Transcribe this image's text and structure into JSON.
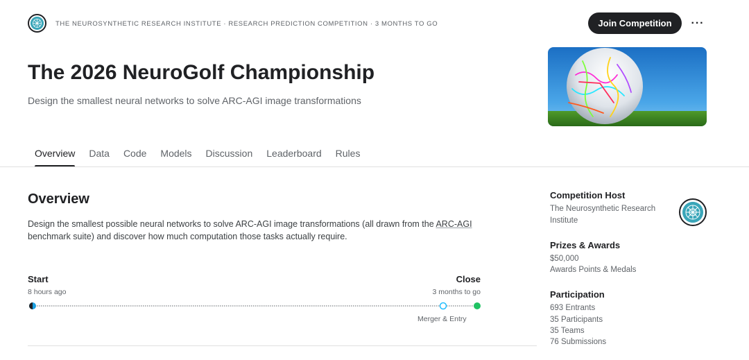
{
  "header": {
    "breadcrumb": "THE NEUROSYNTHETIC RESEARCH INSTITUTE · RESEARCH PREDICTION COMPETITION · 3 MONTHS TO GO",
    "join_label": "Join Competition",
    "more_label": "···",
    "host_logo_icon": "neural-sphere-icon"
  },
  "competition": {
    "title": "The 2026 NeuroGolf Championship",
    "subtitle": "Design the smallest neural networks to solve ARC-AGI image transformations",
    "hero_image": "neon-golf-ball-image"
  },
  "tabs": [
    {
      "label": "Overview",
      "active": true
    },
    {
      "label": "Data",
      "active": false
    },
    {
      "label": "Code",
      "active": false
    },
    {
      "label": "Models",
      "active": false
    },
    {
      "label": "Discussion",
      "active": false
    },
    {
      "label": "Leaderboard",
      "active": false
    },
    {
      "label": "Rules",
      "active": false
    }
  ],
  "overview": {
    "title": "Overview",
    "text_before_link": "Design the smallest possible neural networks to solve ARC-AGI image transformations (all drawn from the ",
    "link_text": "ARC-AGI",
    "text_after_link": " benchmark suite) and discover how much computation those tasks actually require."
  },
  "timeline": {
    "start_label": "Start",
    "start_time": "8 hours ago",
    "close_label": "Close",
    "close_time": "3 months to go",
    "merger_label": "Merger & Entry",
    "colors": {
      "start": "#1a9fe0",
      "merger": "#20beff",
      "close": "#20c263",
      "line": "#5f6368"
    }
  },
  "sidebar": {
    "host_heading": "Competition Host",
    "host_name": "The Neurosynthetic Research Institute",
    "prizes_heading": "Prizes & Awards",
    "prize_amount": "$50,000",
    "prize_extra": "Awards Points & Medals",
    "participation_heading": "Participation",
    "entrants": "693 Entrants",
    "participants": "35 Participants",
    "teams": "35 Teams",
    "submissions": "76 Submissions"
  }
}
